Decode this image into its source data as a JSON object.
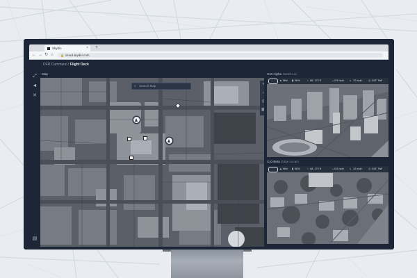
{
  "browser": {
    "tab_title": "Skydio",
    "tab_close": "×",
    "new_tab": "+",
    "url": "cloud.skydio.com",
    "back": "←",
    "forward": "→",
    "reload": "↻",
    "home": "⌂"
  },
  "app": {
    "breadcrumb_parent": "DFR Command /",
    "breadcrumb_current": "Flight Deck",
    "sidebar_icons": [
      "expand-icon",
      "navigate-icon",
      "drone-icon",
      "settings-icon"
    ],
    "map": {
      "label": "Map",
      "search_placeholder": "Search Map",
      "controls": [
        "+",
        "−",
        "◎",
        "▦"
      ]
    },
    "feeds": [
      {
        "name": "X10-Alpha",
        "location": "Sarah Loc",
        "telemetry": {
          "mode": "Mini",
          "battery": "56%",
          "altitude": "Alt. 172 ft",
          "speed": "0.5 mph",
          "wind": "12 mph",
          "heading": "343° NW"
        }
      },
      {
        "name": "X10-Beta",
        "location": "Edge Lucam",
        "telemetry": {
          "mode": "Mini",
          "battery": "56%",
          "altitude": "Alt. 172 ft",
          "speed": "0.5 mph",
          "wind": "12 mph",
          "heading": "343° NW"
        }
      }
    ]
  },
  "colors": {
    "app_background": "#1c2636",
    "accent_light": "#e8ecf1",
    "map_tone": "#5a5f66"
  }
}
